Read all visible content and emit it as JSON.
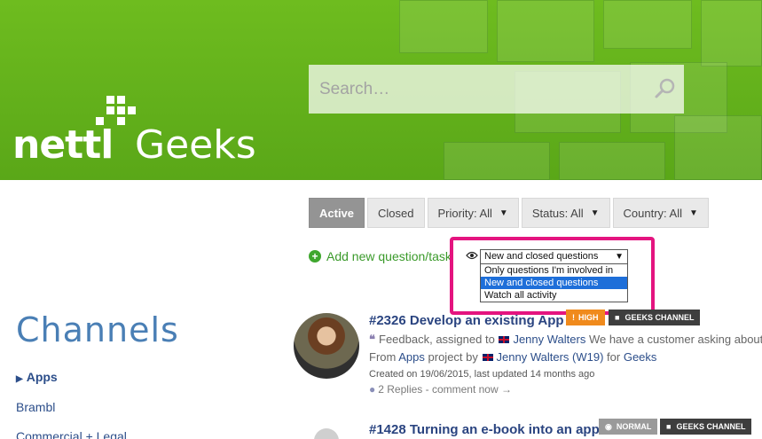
{
  "brand": {
    "logo_primary": "nettl",
    "logo_secondary": "Geeks",
    "color": "#5fb01b"
  },
  "search": {
    "placeholder": "Search…"
  },
  "filters": {
    "active": "Active",
    "closed": "Closed",
    "priority": "Priority: All",
    "status": "Status: All",
    "country": "Country: All"
  },
  "add_question": "Add new question/task",
  "watch": {
    "selected": "New and closed questions",
    "options": [
      "Only questions I'm involved in",
      "New and closed questions",
      "Watch all activity"
    ]
  },
  "channels": {
    "title": "Channels",
    "items": [
      "Apps",
      "Brambl",
      "Commercial + Legal"
    ]
  },
  "questions": [
    {
      "title": "#2326 Develop an existing App",
      "priority": "HIGH",
      "channel": "GEEKS CHANNEL",
      "summary_prefix": "Feedback, assigned to",
      "assignee": "Jenny Walters",
      "summary_text": "We have a customer asking about e",
      "from_prefix": "From",
      "project": "Apps",
      "project_suffix": "project by",
      "author": "Jenny Walters (W19)",
      "for_text": "for",
      "channel_link": "Geeks",
      "created": "Created on 19/06/2015, last updated 14 months ago",
      "replies": "2 Replies",
      "comment": "- comment now →"
    },
    {
      "title": "#1428 Turning an e-book into an app",
      "priority": "NORMAL",
      "channel": "GEEKS CHANNEL"
    }
  ]
}
